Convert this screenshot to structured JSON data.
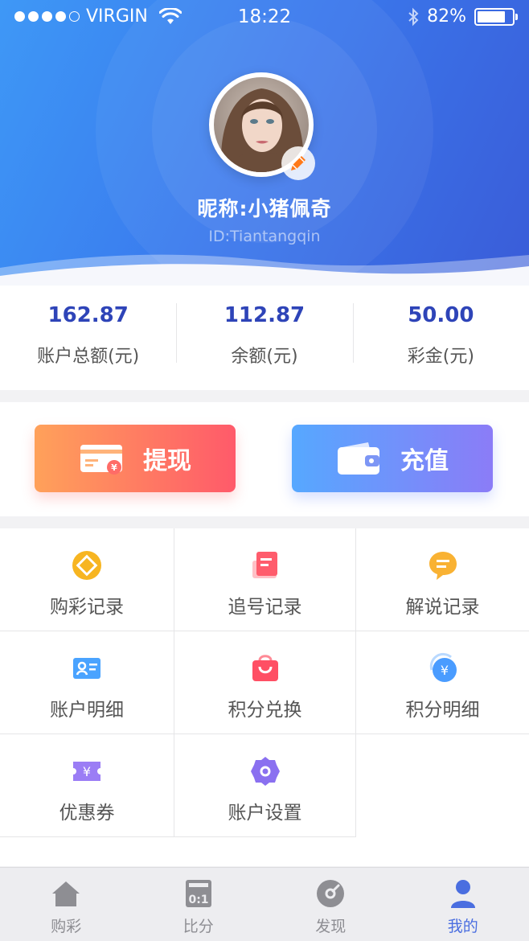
{
  "status_bar": {
    "carrier": "VIRGIN",
    "time": "18:22",
    "battery_percent": "82%",
    "battery_level": 0.82,
    "signal_bars_filled": 4,
    "signal_bars_total": 5
  },
  "profile": {
    "nickname": "昵称:小猪佩奇",
    "user_id": "ID:Tiantangqin"
  },
  "balances": [
    {
      "value": "162.87",
      "label": "账户总额(元)"
    },
    {
      "value": "112.87",
      "label": "余额(元)"
    },
    {
      "value": "50.00",
      "label": "彩金(元)"
    }
  ],
  "actions": {
    "withdraw_label": "提现",
    "recharge_label": "充值"
  },
  "menu": [
    {
      "label": "购彩记录",
      "icon": "diamond-coin-icon",
      "color": "#f7b521"
    },
    {
      "label": "追号记录",
      "icon": "document-icon",
      "color": "#ff5c6c"
    },
    {
      "label": "解说记录",
      "icon": "chat-bubble-icon",
      "color": "#f9b233"
    },
    {
      "label": "账户明细",
      "icon": "id-card-icon",
      "color": "#4aa3ff"
    },
    {
      "label": "积分兑换",
      "icon": "shopping-bag-icon",
      "color": "#ff4f64"
    },
    {
      "label": "积分明细",
      "icon": "yuan-coin-icon",
      "color": "#4a9cff"
    },
    {
      "label": "优惠券",
      "icon": "coupon-icon",
      "color": "#9b7df5"
    },
    {
      "label": "账户设置",
      "icon": "gear-icon",
      "color": "#8a70f0"
    }
  ],
  "tabbar": [
    {
      "label": "购彩",
      "icon": "home-icon",
      "active": false
    },
    {
      "label": "比分",
      "icon": "scoreboard-icon",
      "active": false
    },
    {
      "label": "发现",
      "icon": "compass-icon",
      "active": false
    },
    {
      "label": "我的",
      "icon": "user-icon",
      "active": true
    }
  ],
  "colors": {
    "header_gradient_start": "#3e98f6",
    "header_gradient_end": "#3a5cd8",
    "balance_value": "#2e44b8",
    "tab_active": "#4a6ee0",
    "tab_inactive": "#8e8e93"
  }
}
